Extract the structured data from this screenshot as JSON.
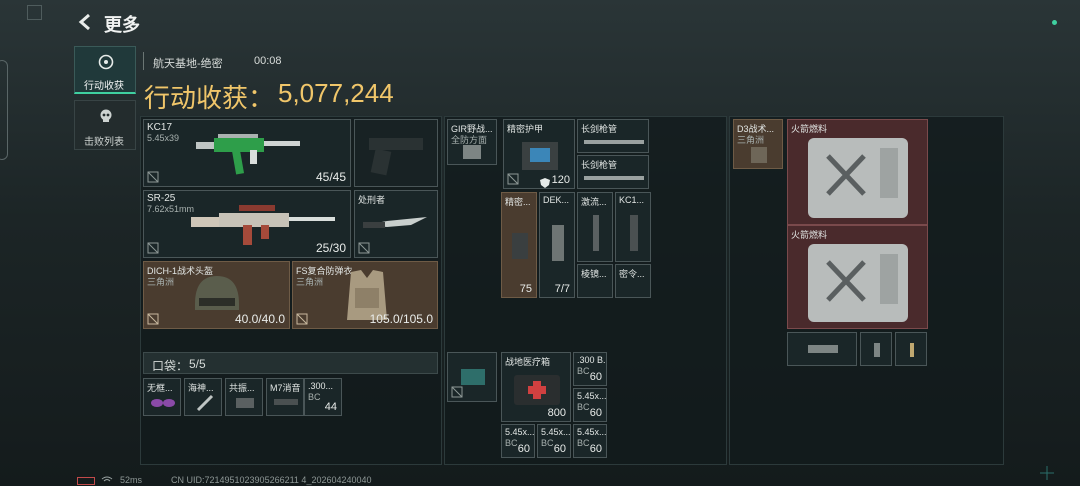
{
  "header": {
    "title": "更多"
  },
  "sidebar": {
    "items": [
      {
        "label": "行动收获",
        "active": true
      },
      {
        "label": "击败列表",
        "active": false
      }
    ]
  },
  "match": {
    "map": "航天基地-绝密",
    "time": "00:08",
    "summary_label": "行动收获：",
    "summary_value": "5,077,244"
  },
  "equipment": {
    "kc17": {
      "name": "KC17",
      "ammo": "5.45x39",
      "count": "45/45"
    },
    "sr25": {
      "name": "SR-25",
      "ammo": "7.62x51mm",
      "count": "25/30"
    },
    "melee": {
      "name": "处刑者"
    },
    "helmet": {
      "name": "DICH-1战术头盔",
      "origin": "三角洲",
      "dur": "40.0/40.0"
    },
    "armor": {
      "name": "FS复合防弹衣",
      "origin": "三角洲",
      "dur": "105.0/105.0"
    }
  },
  "pocket": {
    "label": "口袋：",
    "count": "5/5",
    "items": [
      {
        "name": "无框..."
      },
      {
        "name": "海神..."
      },
      {
        "name": "共振..."
      },
      {
        "name": "M7消音"
      },
      {
        "name": ".300...",
        "sub": "BC",
        "count": "44"
      }
    ]
  },
  "rig": {
    "top": {
      "name": "GIR野战...",
      "sub": "全防方面"
    }
  },
  "backpack": {
    "armor_plate": {
      "name": "精密护甲",
      "count": "120"
    },
    "barrel1": {
      "name": "长剑枪管"
    },
    "barrel2": {
      "name": "长剑枪管"
    },
    "precise": {
      "name": "精密...",
      "count": "75"
    },
    "dek": {
      "name": "DEK...",
      "count": "7/7"
    },
    "laser": {
      "name": "激流..."
    },
    "kc1": {
      "name": "KC1..."
    },
    "scope": {
      "name": "棱镜..."
    },
    "cipher": {
      "name": "密令..."
    }
  },
  "medbox": {
    "name": "战地医疗箱",
    "count": "800"
  },
  "ammo": [
    {
      "name": ".300 B...",
      "sub": "BC",
      "count": "60"
    },
    {
      "name": "5.45x...",
      "sub": "BC",
      "count": "60"
    },
    {
      "name": "5.45x...",
      "sub": "BC",
      "count": "60"
    },
    {
      "name": "5.45x...",
      "sub": "BC",
      "count": "60"
    },
    {
      "name": "5.45x...",
      "sub": "BC",
      "count": "60"
    }
  ],
  "secure": {
    "d3": {
      "name": "D3战术...",
      "sub": "三角洲"
    },
    "fuel1": {
      "name": "火箭燃料"
    },
    "fuel2": {
      "name": "火箭燃料"
    }
  },
  "footer": {
    "ping": "52ms",
    "uid": "CN UID:7214951023905266211 4_202604240040"
  },
  "colors": {
    "accent": "#f0c66a",
    "active": "#3fd0a0"
  }
}
